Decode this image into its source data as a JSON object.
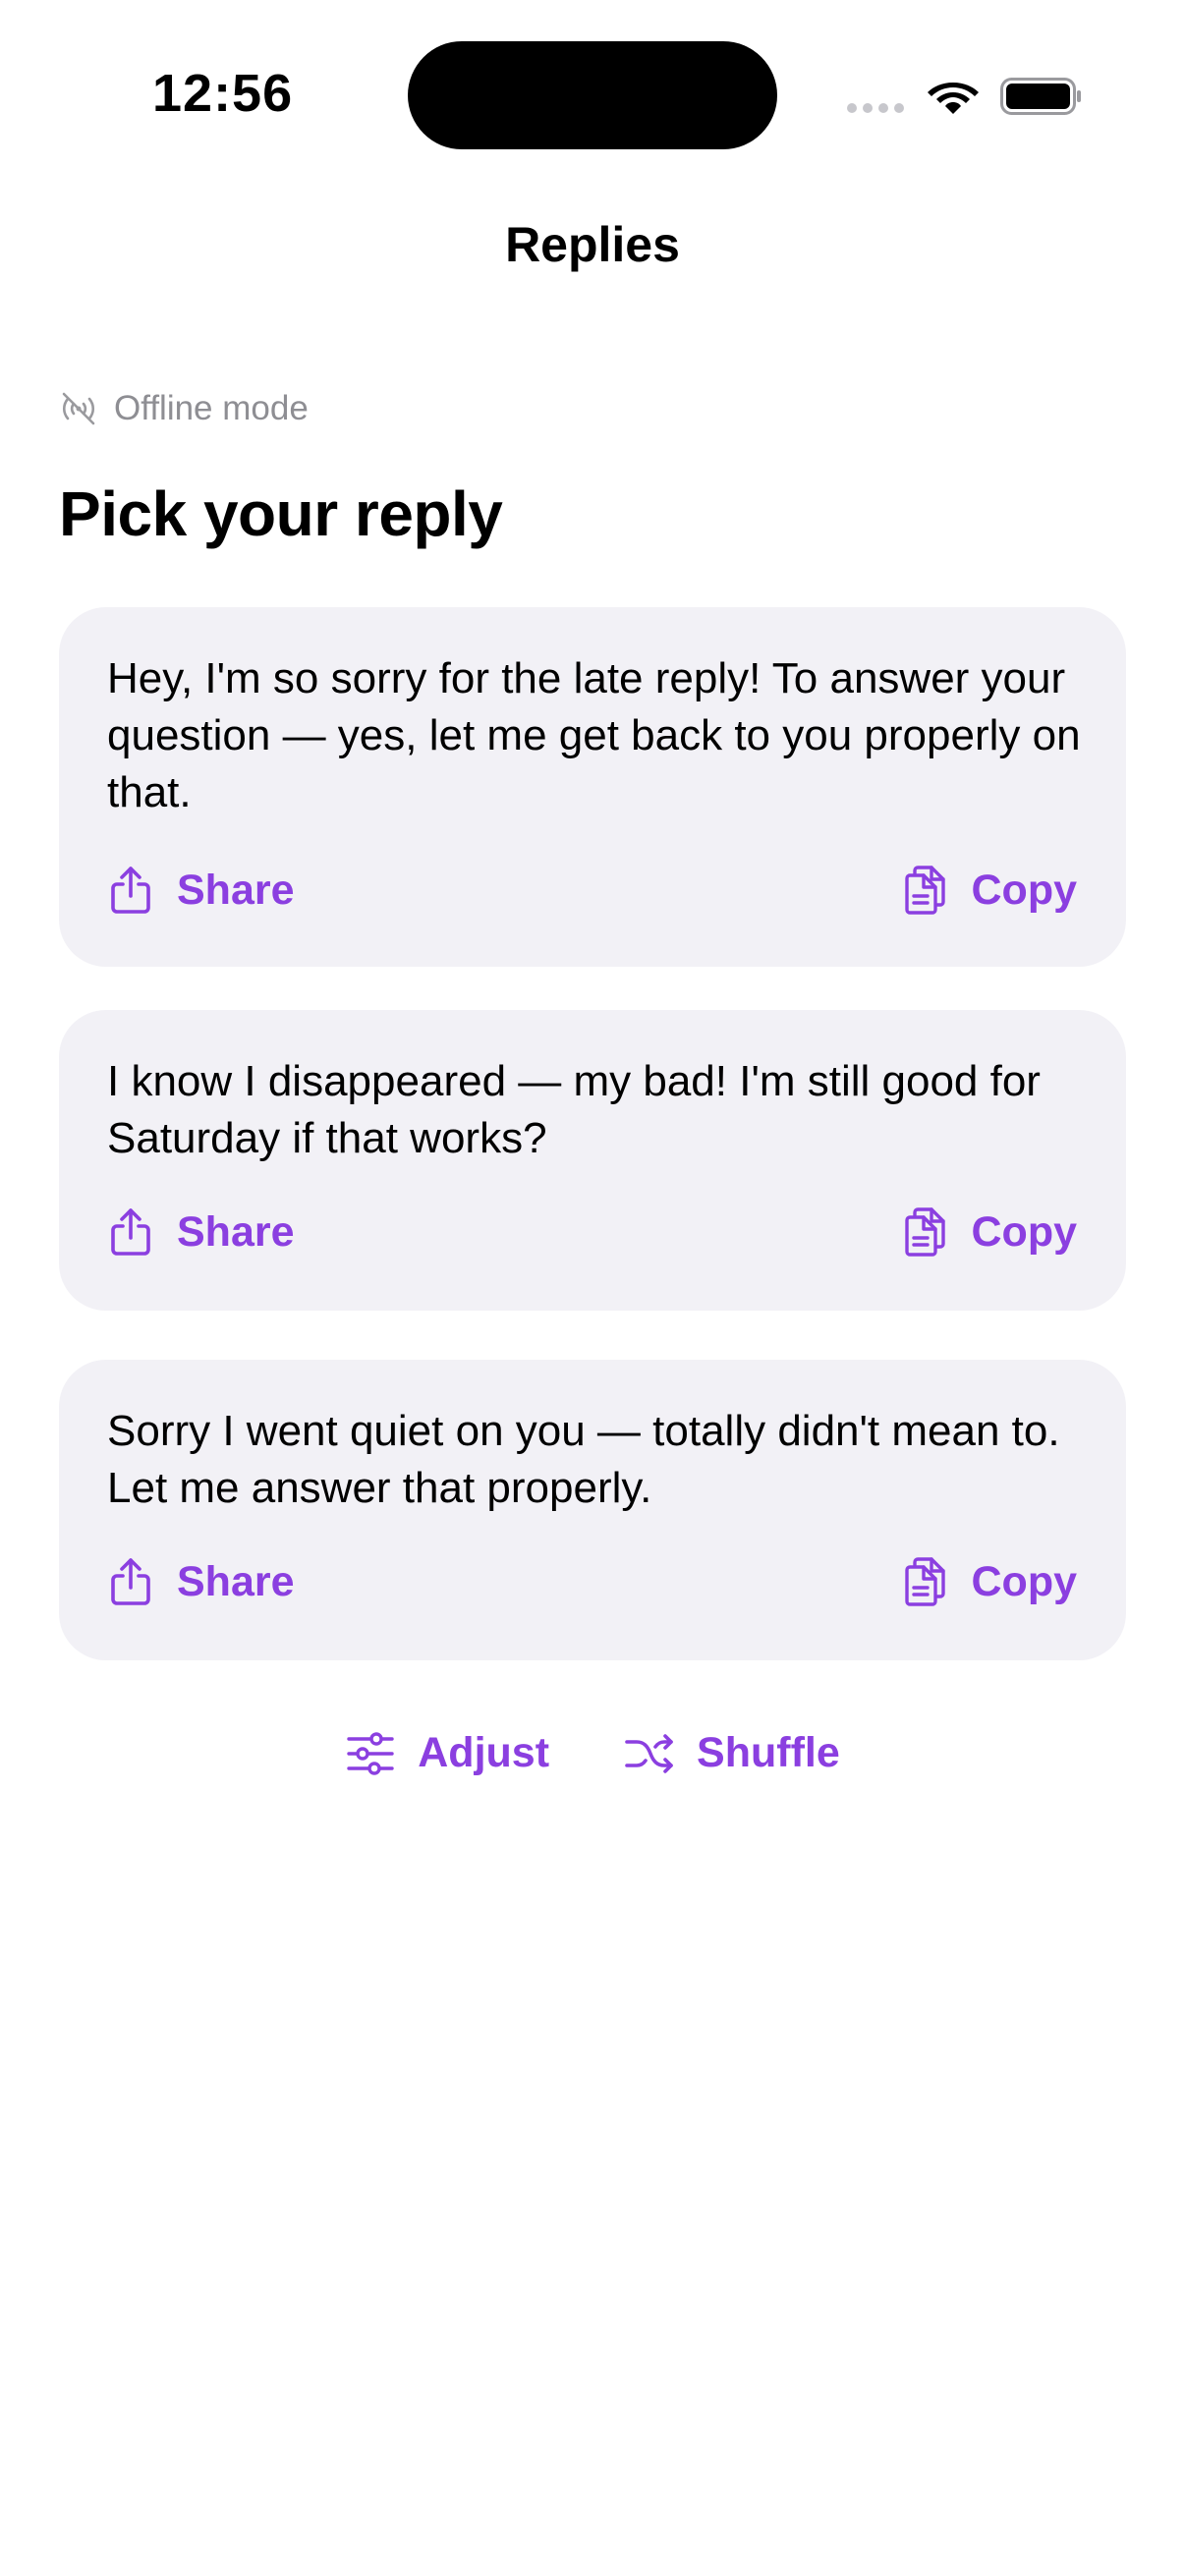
{
  "status_bar": {
    "time": "12:56"
  },
  "nav": {
    "title": "Replies"
  },
  "offline": {
    "label": "Offline mode",
    "icon": "antenna-slash-icon"
  },
  "section_title": "Pick your reply",
  "cards": [
    {
      "text": "Hey, I'm so sorry for the late reply! To answer your question — yes, let me get back to you properly on that.",
      "share_label": "Share",
      "copy_label": "Copy"
    },
    {
      "text": "I know I disappeared — my bad! I'm still good for Saturday if that works?",
      "share_label": "Share",
      "copy_label": "Copy"
    },
    {
      "text": "Sorry I went quiet on you — totally didn't mean to. Let me answer that properly.",
      "share_label": "Share",
      "copy_label": "Copy"
    }
  ],
  "bottom": {
    "adjust_label": "Adjust",
    "shuffle_label": "Shuffle"
  },
  "colors": {
    "accent": "#8b3fe0",
    "card_bg": "#f2f1f6",
    "secondary_text": "#8e8e93"
  }
}
